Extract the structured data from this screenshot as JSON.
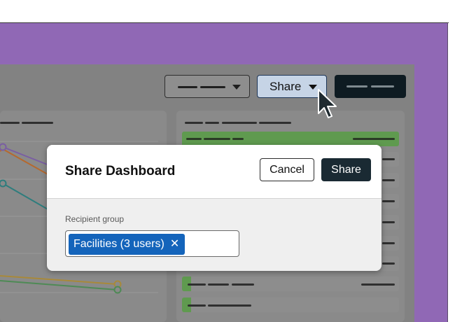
{
  "toolbar": {
    "share_label": "Share",
    "share_icon": "caret-down-icon"
  },
  "modal": {
    "title": "Share Dashboard",
    "cancel_label": "Cancel",
    "share_label": "Share",
    "recipient_label": "Recipient group",
    "recipient_chip": "Facilities (3 users)",
    "remove_icon": "close-icon"
  },
  "colors": {
    "frame": "#9068b5",
    "overlay": "#828282",
    "primary_dark": "#1a2a33",
    "chip": "#1464bb",
    "share_active": "#c6d4e6",
    "row_highlight": "#5f9a4f",
    "line_purple": "#7a5ea3",
    "line_orange": "#b5692e",
    "line_teal": "#2e7d7d",
    "line_gold": "#a8893a",
    "line_green": "#4e8a55"
  }
}
